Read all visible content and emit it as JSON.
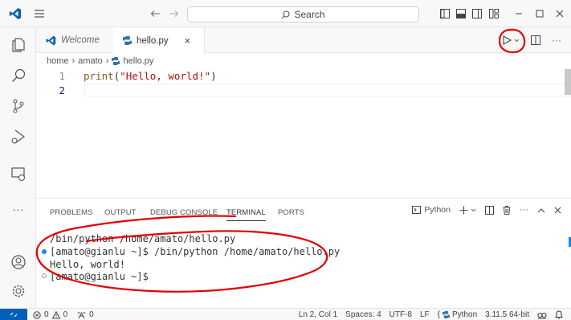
{
  "titlebar": {
    "search_label": "Search"
  },
  "tabs": {
    "welcome_label": "Welcome",
    "active_label": "hello.py",
    "close_glyph": "×"
  },
  "breadcrumb": {
    "parts": [
      "home",
      "amato",
      "hello.py"
    ]
  },
  "editor": {
    "lines": [
      {
        "number": "1",
        "fn": "print",
        "open": "(",
        "str": "\"Hello, world!\"",
        "close": ")"
      },
      {
        "number": "2",
        "text": ""
      }
    ]
  },
  "panel": {
    "tabs": [
      "PROBLEMS",
      "OUTPUT",
      "DEBUG CONSOLE",
      "TERMINAL",
      "PORTS"
    ],
    "active_tab": "TERMINAL",
    "terminal_name": "Python",
    "terminal_lines": [
      "/bin/python /home/amato/hello.py",
      "[amato@gianlu ~]$ /bin/python /home/amato/hello.py",
      "Hello, world!",
      "[amato@gianlu ~]$"
    ]
  },
  "statusbar": {
    "errors": "0",
    "warnings": "0",
    "ports": "0",
    "position": "Ln 2, Col 1",
    "spaces": "Spaces: 4",
    "encoding": "UTF-8",
    "eol": "LF",
    "language": "Python",
    "interpreter": "3.11.5 64-bit"
  },
  "colors": {
    "accent": "#005fb8",
    "annotation_red": "#e00000",
    "python_icon": "#3572a5",
    "vscode_blue": "#0065a9"
  }
}
